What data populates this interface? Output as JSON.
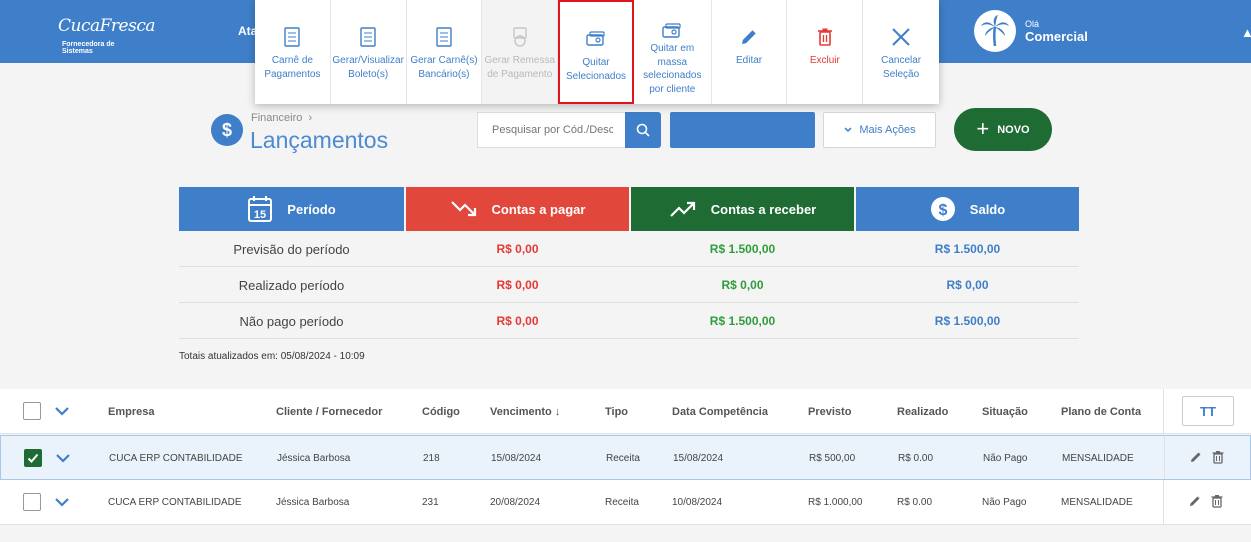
{
  "brand": {
    "logo_text": "CucaFresca",
    "logo_tagline": "Fornecedora de Sistemas"
  },
  "topbar": {
    "cut_text": "Ata",
    "greeting": "Olá",
    "user": "Comercial"
  },
  "toolbar": {
    "actions": [
      {
        "label": "Carnê de Pagamentos",
        "icon": "document-icon"
      },
      {
        "label": "Gerar/Visualizar Boleto(s)",
        "icon": "document-icon"
      },
      {
        "label": "Gerar Carnê(s) Bancário(s)",
        "icon": "document-icon"
      },
      {
        "label": "Gerar Remessa de Pagamento",
        "icon": "money-icon"
      },
      {
        "label": "Quitar Selecionados",
        "icon": "cash-icon"
      },
      {
        "label": "Quitar em massa selecionados por cliente",
        "icon": "cash-icon"
      },
      {
        "label": "Editar",
        "icon": "pencil-icon"
      },
      {
        "label": "Excluir",
        "icon": "trash-icon"
      },
      {
        "label": "Cancelar Seleção",
        "icon": "close-icon"
      }
    ]
  },
  "header": {
    "breadcrumb": "Financeiro",
    "title": "Lançamentos",
    "search_placeholder": "Pesquisar por Cód./Descrição",
    "more_actions": "Mais Ações",
    "new_label": "NOVO"
  },
  "summary": {
    "headers": {
      "periodo": "Período",
      "periodo_day": "15",
      "pagar": "Contas a pagar",
      "receber": "Contas a receber",
      "saldo": "Saldo"
    },
    "rows": [
      {
        "label": "Previsão do período",
        "pagar": "R$ 0,00",
        "receber": "R$ 1.500,00",
        "saldo": "R$ 1.500,00"
      },
      {
        "label": "Realizado período",
        "pagar": "R$ 0,00",
        "receber": "R$ 0,00",
        "saldo": "R$ 0,00"
      },
      {
        "label": "Não pago período",
        "pagar": "R$ 0,00",
        "receber": "R$ 1.500,00",
        "saldo": "R$ 1.500,00"
      }
    ],
    "totals_note": "Totais atualizados em: 05/08/2024 - 10:09"
  },
  "table": {
    "columns": [
      "Empresa",
      "Cliente / Fornecedor",
      "Código",
      "Vencimento",
      "Tipo",
      "Data Competência",
      "Previsto",
      "Realizado",
      "Situação",
      "Plano de Conta"
    ],
    "rows": [
      {
        "checked": true,
        "empresa": "CUCA ERP CONTABILIDADE",
        "cliente": "Jéssica Barbosa",
        "codigo": "218",
        "vencimento": "15/08/2024",
        "tipo": "Receita",
        "competencia": "15/08/2024",
        "previsto": "R$ 500,00",
        "realizado": "R$ 0.00",
        "situacao": "Não Pago",
        "plano": "MENSALIDADE"
      },
      {
        "checked": false,
        "empresa": "CUCA ERP CONTABILIDADE",
        "cliente": "Jéssica Barbosa",
        "codigo": "231",
        "vencimento": "20/08/2024",
        "tipo": "Receita",
        "competencia": "10/08/2024",
        "previsto": "R$ 1.000,00",
        "realizado": "R$ 0.00",
        "situacao": "Não Pago",
        "plano": "MENSALIDADE"
      }
    ]
  },
  "colors": {
    "primary": "#3f7fc9",
    "danger": "#e2473b",
    "success": "#1e6b34",
    "highlight_border": "#e0141a"
  }
}
